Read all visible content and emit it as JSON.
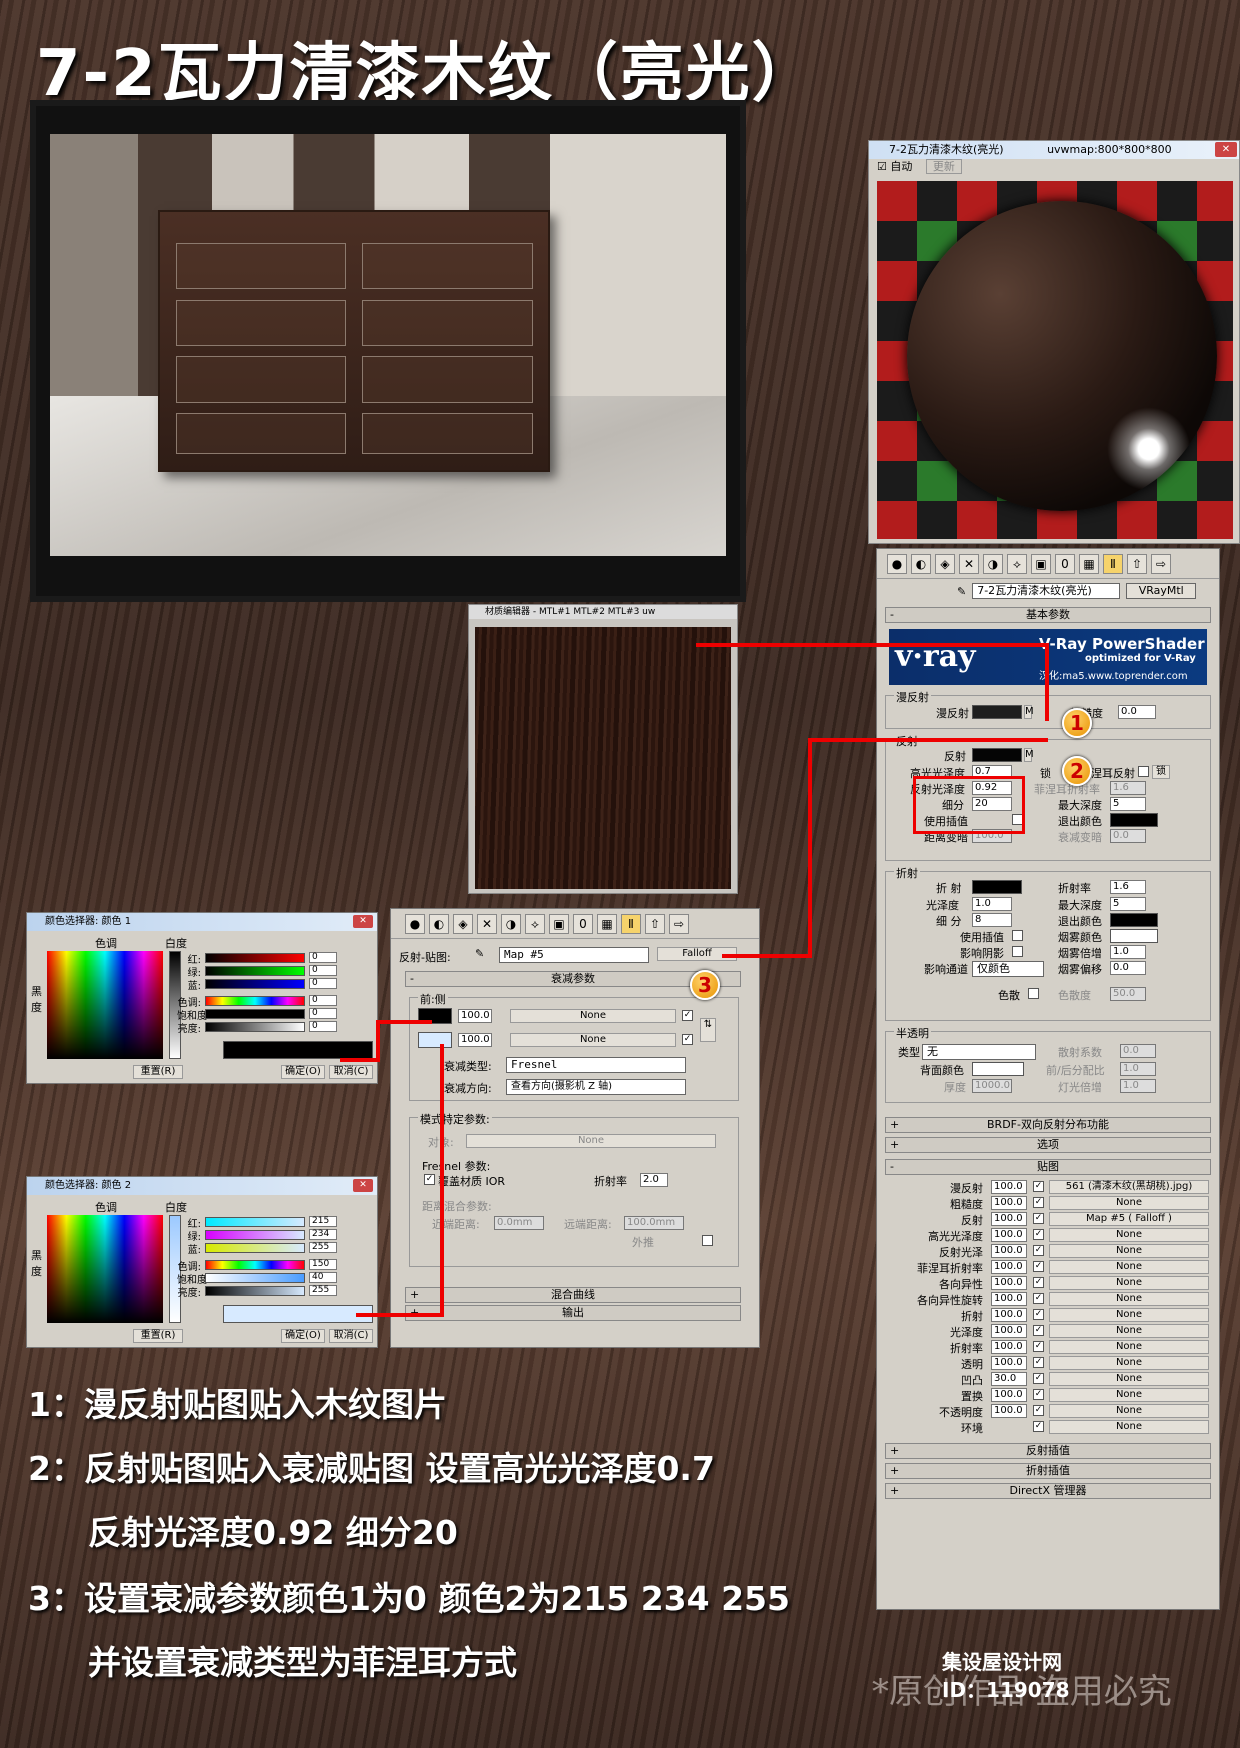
{
  "title": "7-2瓦力清漆木纹（亮光）",
  "vray_window": {
    "title": "7-2瓦力清漆木纹(亮光)",
    "uvw": "uvwmap:800*800*800",
    "auto_label": "自动",
    "update_label": "更新"
  },
  "material": {
    "name": "7-2瓦力清漆木纹(亮光)",
    "type": "VRayMtl",
    "basic_rollout": "基本参数"
  },
  "banner": {
    "logo": "v·ray",
    "line1": "V-Ray PowerShader",
    "line2": "optimized for V-Ray",
    "line3": "汉化:ma5.www.toprender.com"
  },
  "diffuse": {
    "group": "漫反射",
    "label": "漫反射",
    "rough_label": "粗糙度",
    "rough": "0.0"
  },
  "reflection": {
    "group": "反射",
    "label": "反射",
    "hilight_label": "高光光泽度",
    "hilight": "0.7",
    "lock_label": "锁",
    "fresnel_label": "菲涅耳反射",
    "fresnel_lock": "锁",
    "gloss_label": "反射光泽度",
    "gloss": "0.92",
    "fresnel_ior_label": "菲涅耳折射率",
    "fresnel_ior": "1.6",
    "subdivs_label": "细分",
    "subdivs": "20",
    "max_depth_label": "最大深度",
    "max_depth": "5",
    "interp_label": "使用插值",
    "exit_label": "退出颜色",
    "dim_label": "距离变暗",
    "dim": "100.0",
    "falloff_label": "衰减变暗",
    "falloff": "0.0"
  },
  "refraction": {
    "group": "折射",
    "label": "折 射",
    "gloss_label": "光泽度",
    "gloss": "1.0",
    "subdivs_label": "细 分",
    "subdivs": "8",
    "interp_label": "使用插值",
    "shadow_label": "影响阴影",
    "channel_label": "影响通道",
    "channel": "仅颜色",
    "ior_label": "折射率",
    "ior": "1.6",
    "max_depth_label": "最大深度",
    "max_depth": "5",
    "exit_label": "退出颜色",
    "fog_label": "烟雾颜色",
    "fog_mult_label": "烟雾倍增",
    "fog_mult": "1.0",
    "fog_bias_label": "烟雾偏移",
    "fog_bias": "0.0",
    "disp_label": "色散",
    "disp_abbe_label": "色散度",
    "disp_abbe": "50.0"
  },
  "translucency": {
    "group": "半透明",
    "type_label": "类型",
    "type": "无",
    "back_label": "背面颜色",
    "thick_label": "厚度",
    "thick": "1000.0",
    "scatter_label": "散射系数",
    "scatter": "0.0",
    "fb_label": "前/后分配比",
    "fb": "1.0",
    "light_label": "灯光倍增",
    "light": "1.0"
  },
  "rollouts": {
    "brdf": "BRDF-双向反射分布功能",
    "options": "选项",
    "maps": "贴图",
    "refl_interp": "反射插值",
    "refr_interp": "折射插值",
    "directx": "DirectX 管理器"
  },
  "maps": [
    {
      "name": "漫反射",
      "value": "100.0",
      "map": "561 (清漆木纹(黑胡桃).jpg)"
    },
    {
      "name": "粗糙度",
      "value": "100.0",
      "map": "None"
    },
    {
      "name": "反射",
      "value": "100.0",
      "map": "Map #5  ( Falloff )"
    },
    {
      "name": "高光光泽度",
      "value": "100.0",
      "map": "None"
    },
    {
      "name": "反射光泽",
      "value": "100.0",
      "map": "None"
    },
    {
      "name": "菲涅耳折射率",
      "value": "100.0",
      "map": "None"
    },
    {
      "name": "各向异性",
      "value": "100.0",
      "map": "None"
    },
    {
      "name": "各向异性旋转",
      "value": "100.0",
      "map": "None"
    },
    {
      "name": "折射",
      "value": "100.0",
      "map": "None"
    },
    {
      "name": "光泽度",
      "value": "100.0",
      "map": "None"
    },
    {
      "name": "折射率",
      "value": "100.0",
      "map": "None"
    },
    {
      "name": "透明",
      "value": "100.0",
      "map": "None"
    },
    {
      "name": "凹凸",
      "value": "30.0",
      "map": "None"
    },
    {
      "name": "置换",
      "value": "100.0",
      "map": "None"
    },
    {
      "name": "不透明度",
      "value": "100.0",
      "map": "None"
    },
    {
      "name": "环境",
      "value": "",
      "map": "None"
    }
  ],
  "mid_window": {
    "title": "材质编辑器 - MTL#1 MTL#2 MTL#3 uw"
  },
  "falloff": {
    "slot_label": "反射-贴图:",
    "map_name": "Map #5",
    "map_type": "Falloff",
    "rollout": "衰减参数",
    "side_label": "前:侧",
    "v1": "100.0",
    "v2": "100.0",
    "none1": "None",
    "none2": "None",
    "type_label": "衰减类型:",
    "type": "Fresnel",
    "dir_label": "衰减方向:",
    "dir": "查看方向(摄影机 Z 轴)",
    "mode_label": "模式特定参数:",
    "obj_label": "对象:",
    "obj": "None",
    "fresnel_label": "Fresnel 参数:",
    "override_label": "覆盖材质 IOR",
    "ior_label": "折射率",
    "ior": "2.0",
    "blend_label": "距离混合参数:",
    "near_label": "近端距离:",
    "near": "0.0mm",
    "far_label": "远端距离:",
    "far": "100.0mm",
    "extrap_label": "外推",
    "curve_label": "混合曲线",
    "output_label": "输出"
  },
  "picker1": {
    "title": "颜色选择器: 颜色 1",
    "hue": "色调",
    "white": "白度",
    "black": "黑",
    "deg": "度",
    "r": "红:",
    "g": "绿:",
    "b": "蓝:",
    "h": "色调:",
    "s": "饱和度:",
    "v": "亮度:",
    "rv": "0",
    "gv": "0",
    "bv": "0",
    "hv": "0",
    "sv": "0",
    "vv": "0",
    "reset": "重置(R)",
    "ok": "确定(O)",
    "cancel": "取消(C)"
  },
  "picker2": {
    "title": "颜色选择器: 颜色 2",
    "hue": "色调",
    "white": "白度",
    "black": "黑",
    "deg": "度",
    "r": "红:",
    "g": "绿:",
    "b": "蓝:",
    "h": "色调:",
    "s": "饱和度:",
    "v": "亮度:",
    "rv": "215",
    "gv": "234",
    "bv": "255",
    "hv": "150",
    "sv": "40",
    "vv": "255",
    "reset": "重置(R)",
    "ok": "确定(O)",
    "cancel": "取消(C)"
  },
  "notes": [
    "1：漫反射贴图贴入木纹图片",
    "2：反射贴图贴入衰减贴图 设置高光光泽度0.7",
    "反射光泽度0.92 细分20",
    "3：设置衰减参数颜色1为0 颜色2为215 234 255",
    "并设置衰减类型为菲涅耳方式"
  ],
  "markers": [
    "1",
    "2",
    "3"
  ],
  "footer": {
    "site": "集设屋设计网",
    "watermark": "*原创作品 盗用必究",
    "id": "ID：119078"
  },
  "colors": {
    "red": "#e00000",
    "color2": "#d7eaff"
  }
}
